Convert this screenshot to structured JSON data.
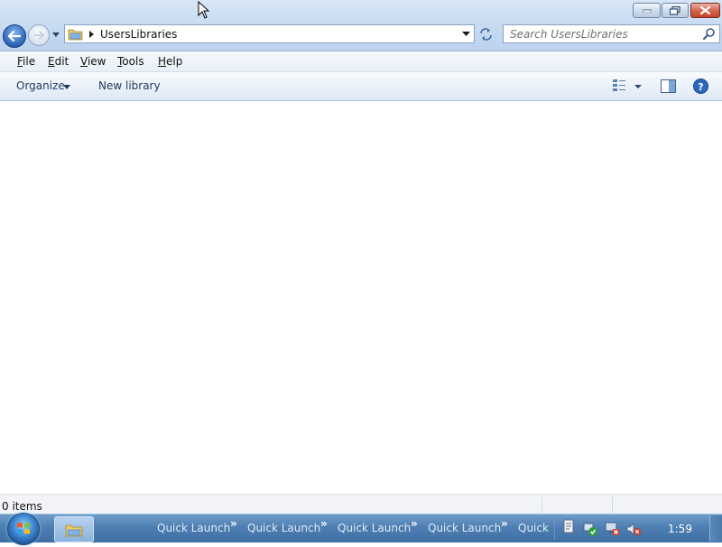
{
  "address": {
    "path": "UsersLibraries"
  },
  "search": {
    "placeholder": "Search UsersLibraries"
  },
  "menu": [
    {
      "pre": "",
      "ul": "F",
      "post": "ile"
    },
    {
      "pre": "",
      "ul": "E",
      "post": "dit"
    },
    {
      "pre": "",
      "ul": "V",
      "post": "iew"
    },
    {
      "pre": "",
      "ul": "T",
      "post": "ools"
    },
    {
      "pre": "",
      "ul": "H",
      "post": "elp"
    }
  ],
  "commands": {
    "organize": "Organize",
    "new_library": "New library"
  },
  "status": {
    "item_count": "0 items"
  },
  "taskbar": {
    "quick_launch": [
      "Quick Launch",
      "Quick Launch",
      "Quick Launch",
      "Quick Launch",
      "Quick L"
    ],
    "chevron": "»",
    "clock": "1:59"
  },
  "colors": {
    "accent": "#2d63b6",
    "close": "#c24427",
    "taskbar": "#4e7fb2"
  },
  "icons": {
    "back": "back-arrow-icon",
    "forward": "forward-arrow-icon",
    "folder": "folder-icon",
    "refresh": "refresh-icon",
    "search": "search-icon",
    "views": "views-icon",
    "preview": "preview-pane-icon",
    "help": "help-icon"
  }
}
